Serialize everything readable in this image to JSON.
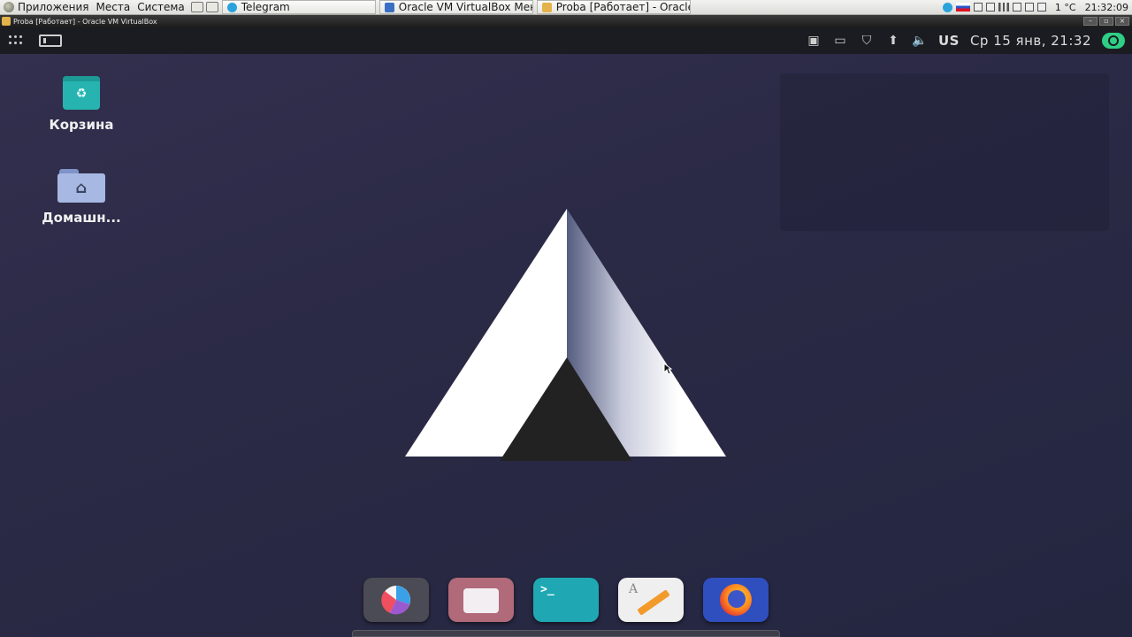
{
  "host_panel": {
    "menus": [
      "Приложения",
      "Места",
      "Система"
    ],
    "tasks": [
      {
        "label": "Telegram",
        "icon": "telegram-icon",
        "color": "#2aa3dd"
      },
      {
        "label": "Oracle VM VirtualBox Мене...",
        "icon": "virtualbox-icon",
        "color": "#3a6fc4"
      },
      {
        "label": "Proba [Работает] - Oracle ...",
        "icon": "virtualbox-vm-icon",
        "color": "#e4b24a"
      }
    ],
    "weather": "1 °C",
    "time": "21:32:09"
  },
  "vm_window": {
    "title": "Proba [Работает] - Oracle VM VirtualBox"
  },
  "guest_topbar": {
    "keyboard_layout": "US",
    "datetime": "Ср 15 янв, 21:32"
  },
  "desktop_icons": [
    {
      "label": "Корзина",
      "icon": "trash-icon"
    },
    {
      "label": "Домашн...",
      "icon": "home-folder-icon"
    }
  ],
  "dock": {
    "apps": [
      {
        "name": "disk-usage-app-icon",
        "color": "#4b4b55"
      },
      {
        "name": "files-app-icon",
        "color": "#b06a7a"
      },
      {
        "name": "terminal-app-icon",
        "color": "#1fa8b4",
        "glyph": ">_"
      },
      {
        "name": "text-editor-app-icon",
        "color": "#efefef"
      },
      {
        "name": "firefox-app-icon",
        "color": "#2f4fbf"
      }
    ]
  },
  "colors": {
    "desktop_bg": "#2b2a46",
    "topbar_bg": "#1b1b22",
    "power_accent": "#2ecf85",
    "trash_accent": "#27b4b0"
  }
}
